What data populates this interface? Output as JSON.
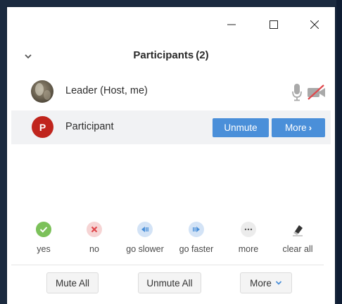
{
  "header": {
    "title": "Participants",
    "count": "(2)"
  },
  "participants": [
    {
      "name": "Leader (Host, me)",
      "avatar": "photo",
      "mic": "unmuted",
      "video": "off"
    },
    {
      "name": "Participant",
      "initial": "P",
      "avatar_color": "#c0251d",
      "actions": {
        "unmute_label": "Unmute",
        "more_label": "More",
        "more_chevron": "›"
      }
    }
  ],
  "reactions": [
    {
      "label": "yes",
      "icon": "check-icon",
      "color": "#7cc15a"
    },
    {
      "label": "no",
      "icon": "x-icon",
      "color": "#e0474c"
    },
    {
      "label": "go slower",
      "icon": "rewind-icon",
      "color": "#4a8fd9"
    },
    {
      "label": "go faster",
      "icon": "fast-forward-icon",
      "color": "#4a8fd9"
    },
    {
      "label": "more",
      "icon": "ellipsis-icon",
      "color": "#555555"
    },
    {
      "label": "clear all",
      "icon": "eraser-icon",
      "color": "#333333"
    }
  ],
  "footer": {
    "mute_all_label": "Mute All",
    "unmute_all_label": "Unmute All",
    "more_label": "More"
  },
  "colors": {
    "accent": "#4a8fd9",
    "row_highlight": "#f1f2f4"
  }
}
